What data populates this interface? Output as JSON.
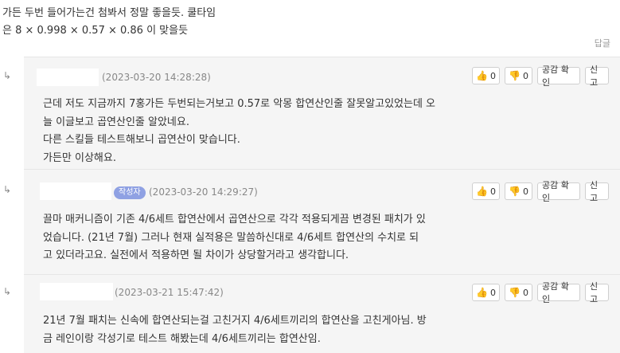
{
  "post_tail": {
    "line1": "가든 두번 들어가는건 첨봐서 정말 좋을듯.  쿨타임",
    "line2": "은 8    ×    0.998    ×    0.57    ×    0.86 이 맞을듯",
    "reply_label": "답글"
  },
  "buttons": {
    "empathy_label": "공감 확인",
    "report_label": "신고"
  },
  "comments": [
    {
      "date": "(2023-03-20 14:28:28)",
      "likes": "0",
      "dislikes": "0",
      "is_author": false,
      "lines": [
        "근데 저도 지금까지 7홍가든 두번되는거보고 0.57로 악몽 합연산인줄 잘못알고있었는데 오",
        "늘 이글보고 곱연산인줄 알았네요.",
        "다른 스킬들 테스트해보니 곱연산이 맞습니다.",
        "가든만 이상해요."
      ]
    },
    {
      "date": "(2023-03-20 14:29:27)",
      "likes": "0",
      "dislikes": "0",
      "is_author": true,
      "author_badge": "작성자",
      "lines": [
        "끌마 매커니즘이 기존 4/6세트 합연산에서 곱연산으로 각각 적용되게끔 변경된 패치가 있",
        "었습니다. (21년 7월)  그러나 현재 실적용은 말씀하신대로 4/6세트 합연산의 수치로 되",
        "고 있더라고요. 실전에서 적용하면 될 차이가 상당할거라고 생각합니다."
      ]
    },
    {
      "date": "(2023-03-21 15:47:42)",
      "likes": "0",
      "dislikes": "0",
      "is_author": false,
      "lines": [
        "21년 7월 패치는 신속에 합연산되는걸 고친거지 4/6세트끼리의 합연산을 고친게아님. 방",
        "금 레인이랑 각성기로 테스트 해봤는데 4/6세트끼리는 합연산임."
      ]
    }
  ]
}
